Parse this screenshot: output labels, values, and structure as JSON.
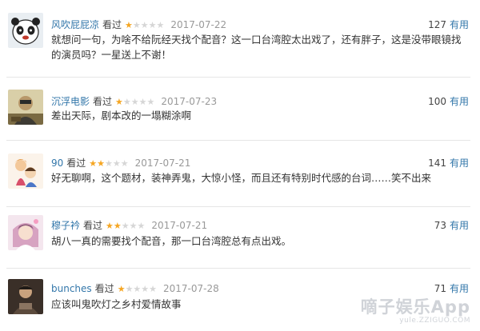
{
  "reviews": [
    {
      "username": "风吹屁屁凉",
      "watched_label": "看过",
      "rating": 1,
      "date": "2017-07-22",
      "votes": "127",
      "useful_label": "有用",
      "comment": "就想问一句，为啥不给阮经天找个配音？这一口台湾腔太出戏了，还有胖子，这是没带眼镜找的演员吗？一星送上不谢！"
    },
    {
      "username": "沉浮电影",
      "watched_label": "看过",
      "rating": 1,
      "date": "2017-07-23",
      "votes": "100",
      "useful_label": "有用",
      "comment": "差出天际，剧本改的一塌糊涂啊"
    },
    {
      "username": "90",
      "watched_label": "看过",
      "rating": 2,
      "date": "2017-07-21",
      "votes": "141",
      "useful_label": "有用",
      "comment": "好无聊啊，这个题材，装神弄鬼，大惊小怪，而且还有特别时代感的台词……笑不出来"
    },
    {
      "username": "穆子衿",
      "watched_label": "看过",
      "rating": 2,
      "date": "2017-07-21",
      "votes": "73",
      "useful_label": "有用",
      "comment": "胡八一真的需要找个配音，那一口台湾腔总有点出戏。"
    },
    {
      "username": "bunches",
      "watched_label": "看过",
      "rating": 1,
      "date": "2017-07-28",
      "votes": "71",
      "useful_label": "有用",
      "comment": "应该叫鬼吹灯之乡村爱情故事"
    }
  ],
  "watermark": {
    "brand": "嘀子娱乐App",
    "url": "yule.ZZIGUO.COM"
  },
  "colors": {
    "username": "#3377aa",
    "star_on": "#f5a623",
    "star_off": "#d6d6d6",
    "date": "#999999"
  }
}
